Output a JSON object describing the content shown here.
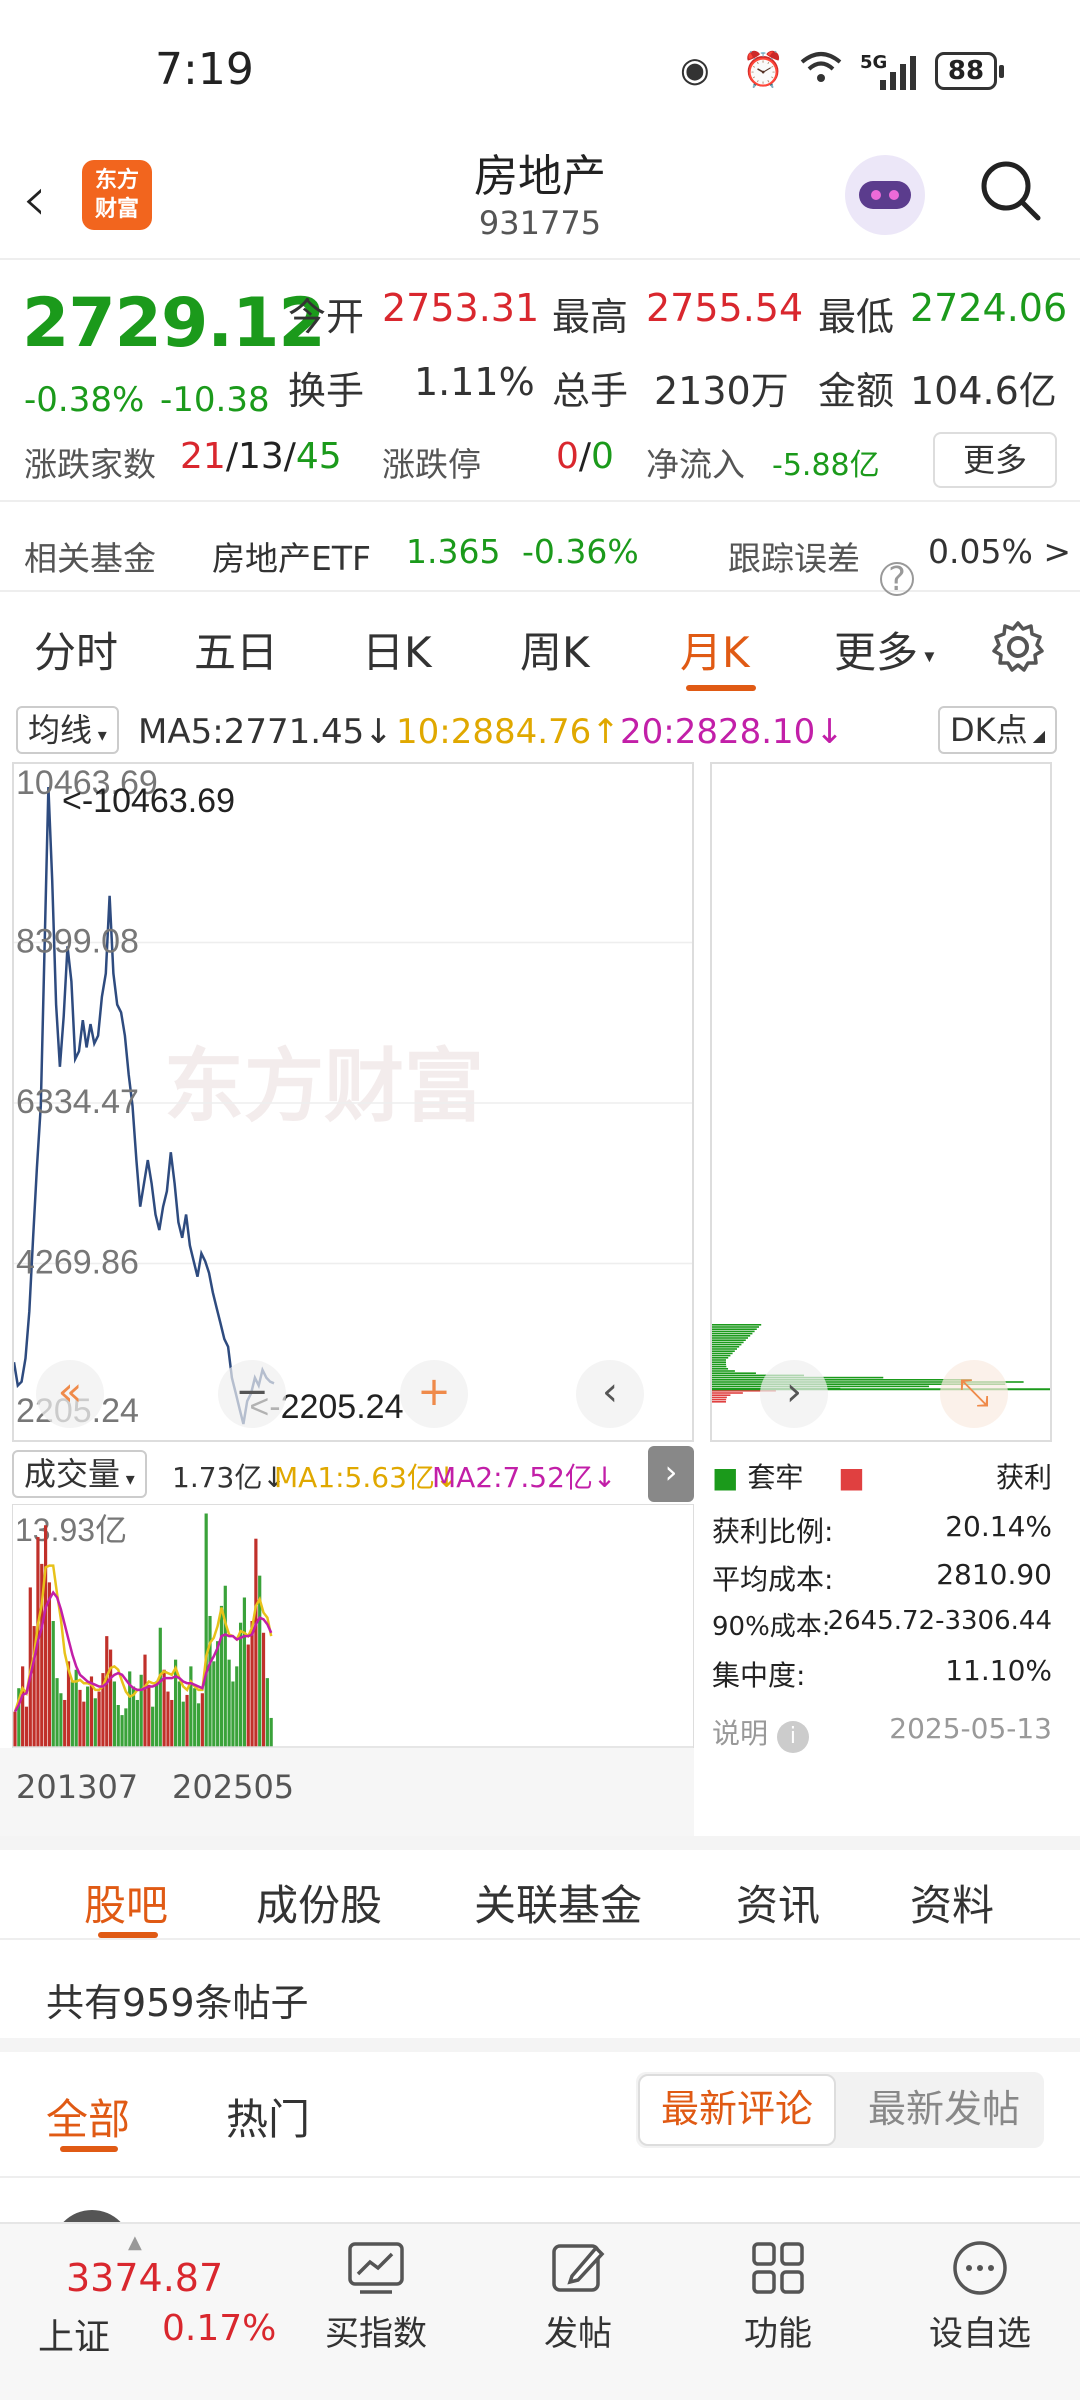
{
  "status_bar": {
    "time": "7:19",
    "battery": "88",
    "net": "5G"
  },
  "header": {
    "title": "房地产",
    "code": "931775",
    "logo_line1": "东方",
    "logo_line2": "财富"
  },
  "quote": {
    "price": "2729.12",
    "change_pct": "-0.38%",
    "change": "-10.38",
    "open_label": "今开",
    "open": "2753.31",
    "high_label": "最高",
    "high": "2755.54",
    "low_label": "最低",
    "low": "2724.06",
    "turnover_label": "换手",
    "turnover": "1.11%",
    "volume_label": "总手",
    "volume": "2130万",
    "amount_label": "金额",
    "amount": "104.6亿",
    "breadth_label": "涨跌家数",
    "breadth_up": "21",
    "breadth_flat": "13",
    "breadth_down": "45",
    "sep": "/",
    "limit_label": "涨跌停",
    "limit_up": "0",
    "limit_down": "0",
    "netflow_label": "净流入",
    "netflow": "-5.88亿",
    "more": "更多"
  },
  "fund": {
    "label": "相关基金",
    "name": "房地产ETF",
    "price": "1.365",
    "pct": "-0.36%",
    "track_label": "跟踪误差",
    "track_value": "0.05% >"
  },
  "tabs": [
    "分时",
    "五日",
    "日K",
    "周K",
    "月K",
    "更多"
  ],
  "ma": {
    "select": "均线",
    "ma5": "MA5:2771.45↓",
    "ma10": "10:2884.76↑",
    "ma20": "20:2828.10↓",
    "dk": "DK点"
  },
  "price_axis": {
    "labels": [
      "10463.69",
      "8399.08",
      "6334.47",
      "4269.86",
      "2205.24"
    ],
    "max_marker": "<-10463.69",
    "min_marker": "<-2205.24"
  },
  "watermark": "东方财富",
  "volume_header": {
    "select": "成交量",
    "vol": "1.73亿↓",
    "ma1": "MA1:5.63亿↓",
    "ma2": "MA2:7.52亿↓"
  },
  "volume_axis": {
    "max": "13.93亿",
    "start": "201307",
    "end": "202505"
  },
  "cyq": {
    "legend_trap": "套牢",
    "legend_profit": "获利",
    "profit_ratio_label": "获利比例:",
    "profit_ratio": "20.14%",
    "avg_cost_label": "平均成本:",
    "avg_cost": "2810.90",
    "cost90_label": "90%成本:",
    "cost90": "2645.72-3306.44",
    "concentration_label": "集中度:",
    "concentration": "11.10%",
    "note_label": "说明",
    "date": "2025-05-13"
  },
  "sections": [
    "股吧",
    "成份股",
    "关联基金",
    "资讯",
    "资料"
  ],
  "posts": {
    "count": "共有959条帖子",
    "filter_all": "全部",
    "filter_hot": "热门",
    "sort_latest_comment": "最新评论",
    "sort_latest_post": "最新发帖"
  },
  "bottom": {
    "index_value": "3374.87",
    "index_name": "上证",
    "index_pct": "0.17%",
    "buy": "买指数",
    "post": "发帖",
    "func": "功能",
    "watch": "设自选"
  },
  "colors": {
    "up": "#d9272e",
    "down": "#1b9a1b",
    "accent": "#e05a14",
    "line": "#2e4b7f"
  },
  "chart_data": {
    "type": "line",
    "x_range": [
      "201307",
      "202505"
    ],
    "ylim": [
      2205.24,
      10463.69
    ],
    "y": [
      3000,
      2700,
      2750,
      3050,
      3650,
      4600,
      5500,
      6300,
      8350,
      10400,
      9200,
      7600,
      6800,
      7450,
      8350,
      7900,
      6900,
      7000,
      7400,
      7050,
      7350,
      7100,
      7200,
      7700,
      8000,
      9000,
      8000,
      7600,
      7500,
      7200,
      6700,
      6300,
      5600,
      5000,
      5300,
      5600,
      5300,
      4900,
      4700,
      5000,
      5200,
      5700,
      5300,
      4800,
      4600,
      4900,
      4500,
      4300,
      4100,
      4400,
      4300,
      4150,
      3900,
      3700,
      3500,
      3300,
      3200,
      2800,
      2600,
      2400,
      2205,
      2500,
      2600,
      2800,
      2700,
      2900,
      2800,
      2750,
      2729
    ],
    "volume": [
      2.1,
      3.5,
      4.8,
      2.4,
      9.5,
      7.2,
      12.5,
      10.9,
      13.2,
      9.8,
      7.5,
      4.1,
      3.2,
      2.8,
      5.1,
      3.9,
      4.6,
      3.4,
      2.7,
      3.6,
      4.2,
      2.9,
      3.3,
      4.4,
      6.6,
      5.8,
      3.9,
      2.5,
      1.9,
      2.3,
      4.5,
      3.6,
      2.8,
      4.3,
      5.5,
      3.7,
      2.4,
      3.9,
      7.1,
      4.6,
      3.3,
      2.8,
      5.2,
      3.9,
      2.7,
      3.1,
      4.8,
      3.5,
      2.6,
      3.2,
      13.9,
      7.8,
      5.1,
      6.3,
      8.4,
      9.6,
      5.2,
      3.9,
      4.8,
      7.4,
      8.9,
      6.1,
      7.5,
      12.4,
      10.2,
      6.8,
      4.1,
      1.73
    ],
    "ma1": [
      2.1,
      2.8,
      3.5,
      3.2,
      4.5,
      5.5,
      7.3,
      8.5,
      10.7,
      10.8,
      10.8,
      9.1,
      7.6,
      5.6,
      4.6,
      3.9,
      3.9,
      4.0,
      3.8,
      3.8,
      3.7,
      3.4,
      3.4,
      3.6,
      4.2,
      4.7,
      4.8,
      4.6,
      3.9,
      3.3,
      3.0,
      3.1,
      3.4,
      3.4,
      3.6,
      3.9,
      3.8,
      3.8,
      4.3,
      4.5,
      4.4,
      4.3,
      4.7,
      4.1,
      3.6,
      3.4,
      3.9,
      3.6,
      3.4,
      3.4,
      5.4,
      6.2,
      6.5,
      7.2,
      8.3,
      7.4,
      6.7,
      6.6,
      6.4,
      6.9,
      6.8,
      6.6,
      7.1,
      8.4,
      8.8,
      8.0,
      7.7,
      6.6
    ],
    "ma2": [
      2.1,
      2.5,
      3.1,
      3.2,
      4.2,
      5.2,
      6.3,
      7.1,
      8.3,
      8.8,
      9.2,
      8.9,
      8.2,
      7.3,
      6.4,
      5.5,
      4.8,
      4.3,
      4.1,
      3.9,
      3.8,
      3.7,
      3.6,
      3.6,
      3.8,
      4.1,
      4.3,
      4.4,
      4.3,
      4.0,
      3.7,
      3.5,
      3.4,
      3.4,
      3.5,
      3.6,
      3.6,
      3.7,
      3.9,
      4.1,
      4.1,
      4.1,
      4.2,
      4.1,
      3.9,
      3.8,
      3.8,
      3.7,
      3.6,
      3.5,
      4.4,
      5.0,
      5.4,
      5.9,
      6.6,
      6.7,
      6.6,
      6.6,
      6.4,
      6.5,
      6.6,
      6.6,
      6.7,
      7.3,
      7.7,
      7.6,
      7.3,
      6.8
    ]
  }
}
